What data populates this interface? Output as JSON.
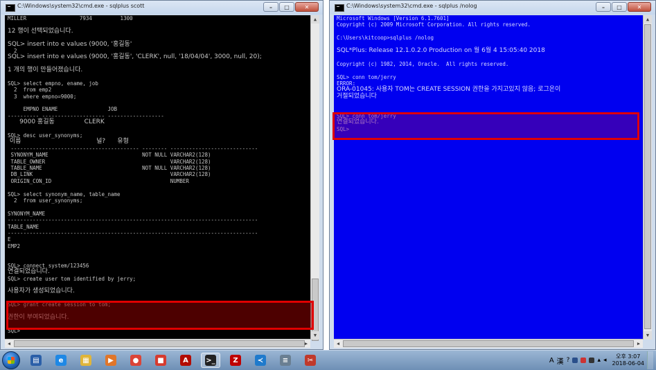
{
  "left_window": {
    "title": "C:\\Windows\\system32\\cmd.exe - sqlplus  scott",
    "lines": [
      "MILLER                 7934         1300",
      "",
      "12 행이 선택되었습니다.",
      "",
      "SQL> insert into e values (9000, '홍길동'",
      "  2",
      "SQL> insert into e values (9000, '홍길동', 'CLERK', null, '18/04/04', 3000, null, 20);",
      "",
      "1 개의 행이 만들어졌습니다.",
      "",
      "SQL> select empno, ename, job",
      "  2  from emp2",
      "  3  where empno=9000;",
      "",
      "     EMPNO ENAME                JOB",
      "---------- -------------------- ------------------",
      "      9000 홍길동               CLERK",
      "",
      "SQL> desc user_synonyms;",
      " 이름                                      널?      유형",
      " ----------------------------------------- -------- ----------------------------",
      " SYNONYM_NAME                              NOT NULL VARCHAR2(128)",
      " TABLE_OWNER                                        VARCHAR2(128)",
      " TABLE_NAME                                NOT NULL VARCHAR2(128)",
      " DB_LINK                                            VARCHAR2(128)",
      " ORIGIN_CON_ID                                      NUMBER",
      "",
      "SQL> select synonym_name, table_name",
      "  2  from user_synonyms;",
      "",
      "SYNONYM_NAME",
      "--------------------------------------------------------------------------------",
      "TABLE_NAME",
      "--------------------------------------------------------------------------------",
      "E",
      "EMP2",
      "",
      "",
      "SQL> connect system/123456",
      "연결되었습니다.",
      "SQL> create user tom identified by jerry;",
      "",
      "사용자가 생성되었습니다.",
      "",
      "SQL> grant create session to tom;",
      "",
      "권한이 부여되었습니다.",
      "",
      "SQL>"
    ]
  },
  "right_window": {
    "title": "C:\\Windows\\system32\\cmd.exe - sqlplus  /nolog",
    "lines": [
      "Microsoft Windows [Version 6.1.7601]",
      "Copyright (c) 2009 Microsoft Corporation. All rights reserved.",
      "",
      "C:\\Users\\kitcoop>sqlplus /nolog",
      "",
      "SQL*Plus: Release 12.1.0.2.0 Production on 월 6월 4 15:05:40 2018",
      "",
      "Copyright (c) 1982, 2014, Oracle.  All rights reserved.",
      "",
      "SQL> conn tom/jerry",
      "ERROR:",
      "ORA-01045: 사용자 TOM는 CREATE SESSION 권한을 가지고있지 않음; 로그온이",
      "거절되었습니다",
      "",
      "",
      "SQL> conn tom/jerry",
      "연결되었습니다.",
      "SQL>"
    ]
  },
  "window_controls": {
    "minimize": "–",
    "maximize": "□",
    "close": "✕"
  },
  "taskbar": {
    "apps": [
      {
        "name": "explorer",
        "icon": "folder-icon",
        "color": "#2b5fa8"
      },
      {
        "name": "ie",
        "icon": "internet-explorer-icon",
        "color": "#1e88e5"
      },
      {
        "name": "files",
        "icon": "file-manager-icon",
        "color": "#e0b53a"
      },
      {
        "name": "media",
        "icon": "media-player-icon",
        "color": "#e0762a"
      },
      {
        "name": "chrome",
        "icon": "chrome-icon",
        "color": "#db4437"
      },
      {
        "name": "app",
        "icon": "app-icon",
        "color": "#d63b2f"
      },
      {
        "name": "acrobat",
        "icon": "acrobat-icon",
        "color": "#b30b00"
      },
      {
        "name": "cmd",
        "icon": "command-prompt-icon",
        "color": "#222222"
      },
      {
        "name": "filezilla",
        "icon": "filezilla-icon",
        "color": "#bf0000"
      },
      {
        "name": "vscode",
        "icon": "vscode-icon",
        "color": "#1f7acc"
      },
      {
        "name": "sqldev",
        "icon": "database-icon",
        "color": "#6a7f92"
      },
      {
        "name": "snip",
        "icon": "snipping-tool-icon",
        "color": "#c0392b"
      }
    ],
    "ime": "A",
    "ime_han": "漢",
    "time": "오후 3:07",
    "date": "2018-06-04"
  }
}
